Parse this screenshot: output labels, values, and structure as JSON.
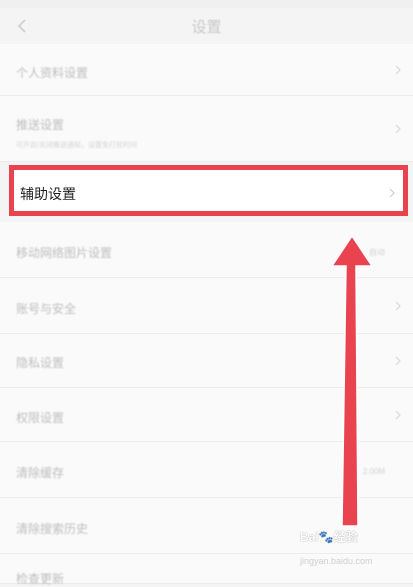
{
  "header": {
    "title": "设置"
  },
  "rows": [
    {
      "label": "个人资料设置",
      "sub": "",
      "value": ""
    },
    {
      "label": "推送设置",
      "sub": "可开启/关闭推送通知，设置免打扰时间",
      "value": ""
    },
    {
      "label": "辅助设置",
      "sub": "",
      "value": "",
      "highlighted": true
    },
    {
      "label": "移动网络图片设置",
      "sub": "",
      "value": "自动"
    },
    {
      "label": "账号与安全",
      "sub": "",
      "value": ""
    },
    {
      "label": "隐私设置",
      "sub": "",
      "value": ""
    },
    {
      "label": "权限设置",
      "sub": "",
      "value": ""
    },
    {
      "label": "清除缓存",
      "sub": "",
      "value": "2.00M"
    },
    {
      "label": "清除搜索历史",
      "sub": "",
      "value": ""
    },
    {
      "label": "检查更新",
      "sub": "",
      "value": ""
    }
  ],
  "annotation": {
    "box_color": "#e8434f",
    "arrow_color": "#e8434f"
  },
  "watermark": {
    "brand": "Bai",
    "brand_suffix": "经验",
    "url": "jingyan.baidu.com"
  }
}
